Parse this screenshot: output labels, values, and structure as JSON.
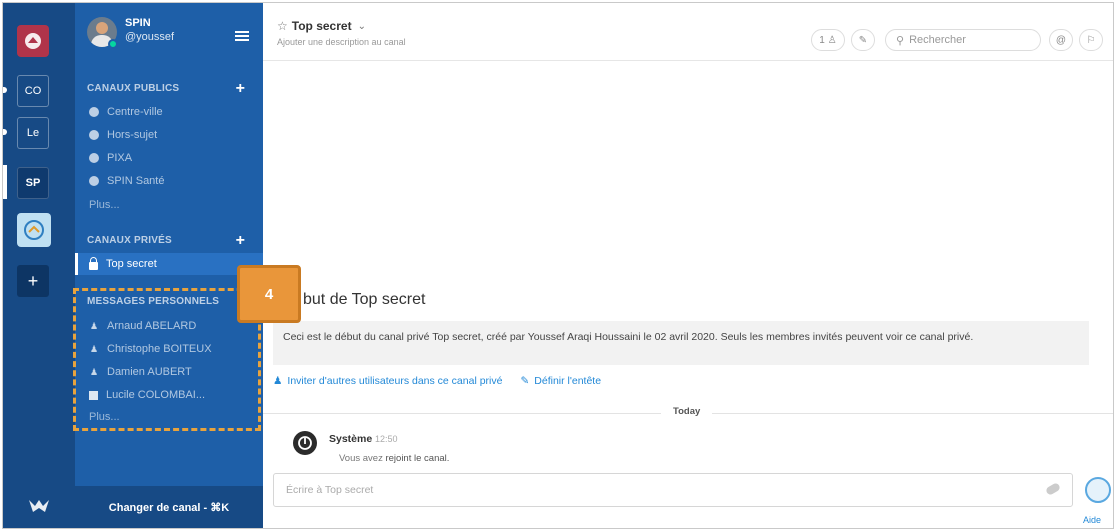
{
  "teams": {
    "items": [
      {
        "label": "CO"
      },
      {
        "label": "Le"
      },
      {
        "label": "SP"
      }
    ],
    "add_label": "+"
  },
  "sidebar": {
    "team_name": "SPIN",
    "username": "@youssef",
    "public_channels": {
      "title": "CANAUX PUBLICS",
      "items": [
        "Centre-ville",
        "Hors-sujet",
        "PIXA",
        "SPIN Santé"
      ],
      "more": "Plus..."
    },
    "private_channels": {
      "title": "CANAUX PRIVÉS",
      "items": [
        "Top secret"
      ]
    },
    "direct_messages": {
      "title": "MESSAGES PERSONNELS",
      "items": [
        "Arnaud ABELARD",
        "Christophe BOITEUX",
        "Damien AUBERT",
        "Lucile COLOMBAI..."
      ],
      "more": "Plus..."
    },
    "switch_channel": "Changer de canal - ⌘K"
  },
  "highlight": {
    "badge": "4",
    "color": "#e8a33d"
  },
  "header": {
    "channel_name": "Top secret",
    "description": "Ajouter une description au canal",
    "member_count": "1",
    "search_placeholder": "Rechercher"
  },
  "intro": {
    "title": "but de Top secret",
    "text": "Ceci est le début du canal privé Top secret, créé par Youssef Araqi Houssaini le 02 avril 2020. Seuls les membres invités peuvent voir ce canal privé.",
    "invite": "Inviter d'autres utilisateurs dans ce canal privé",
    "set_header": "Définir l'entête"
  },
  "messages": {
    "divider": "Today",
    "author": "Système",
    "time": "12:50",
    "text_prefix": "Vous avez ",
    "text_bold": "rejoint le canal."
  },
  "composer": {
    "placeholder": "Écrire à Top secret",
    "help": "Aide"
  }
}
